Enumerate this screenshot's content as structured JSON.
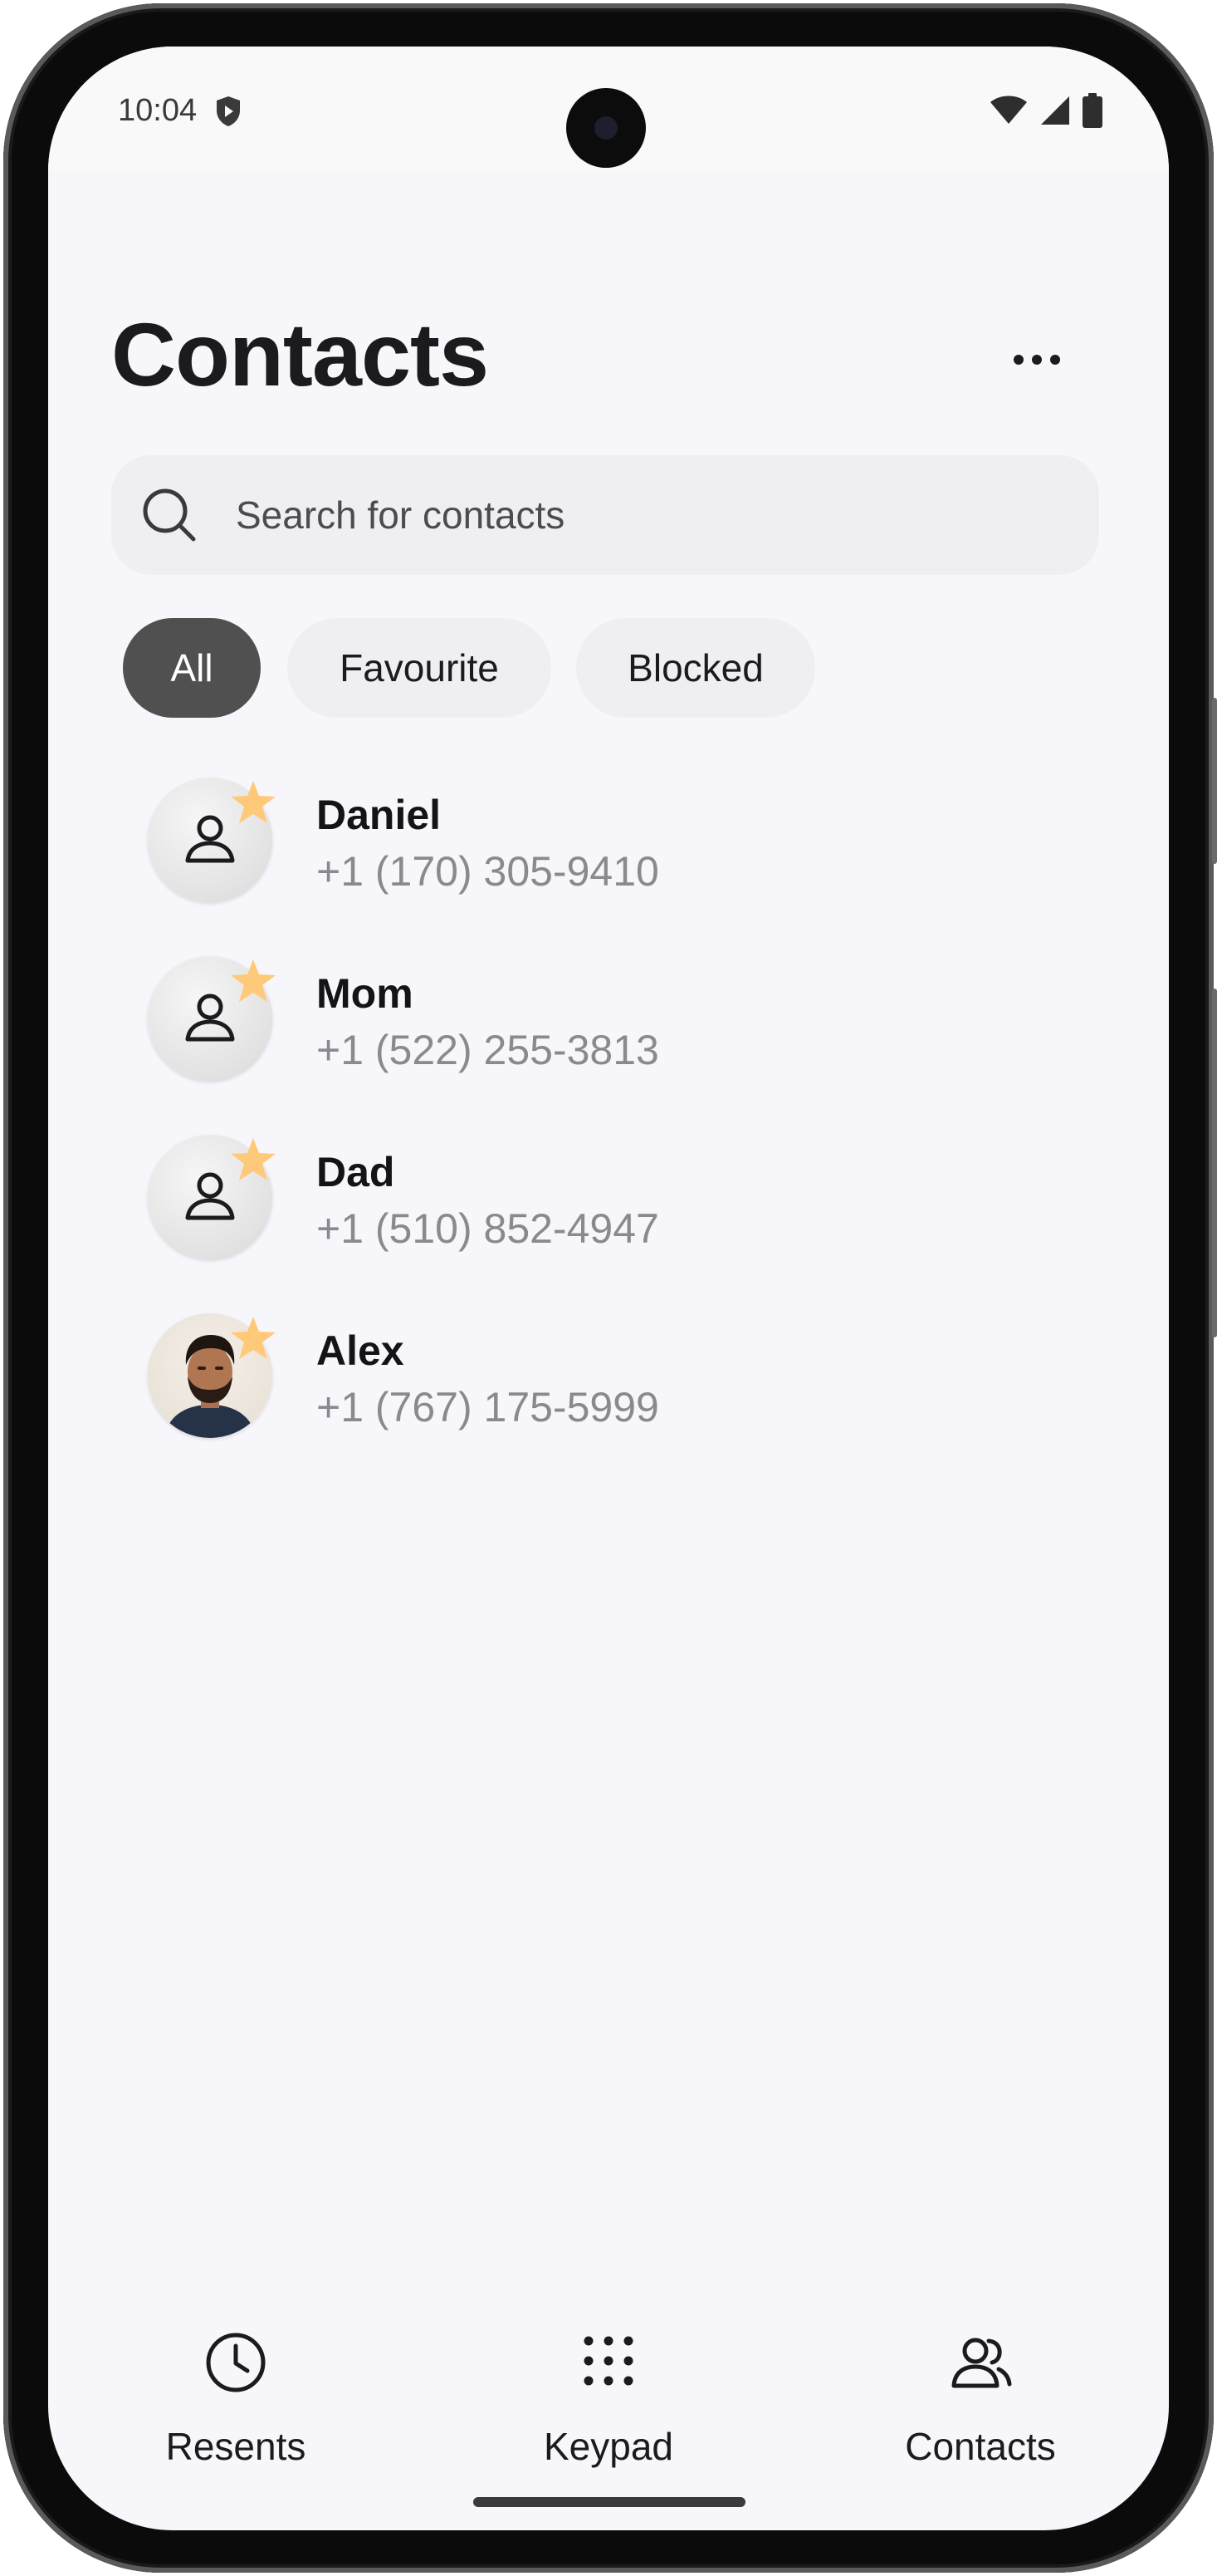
{
  "status_bar": {
    "time": "10:04",
    "icons": [
      "shield-play-icon",
      "wifi-icon",
      "signal-icon",
      "battery-icon"
    ]
  },
  "header": {
    "title": "Contacts",
    "more_icon": "more-horizontal-icon"
  },
  "search": {
    "placeholder": "Search for contacts",
    "value": ""
  },
  "filters": [
    {
      "label": "All",
      "selected": true
    },
    {
      "label": "Favourite",
      "selected": false
    },
    {
      "label": "Blocked",
      "selected": false
    }
  ],
  "contacts": [
    {
      "name": "Daniel",
      "phone": "+1 (170) 305-9410",
      "favourite": true,
      "avatar": "person-placeholder-icon"
    },
    {
      "name": "Mom",
      "phone": "+1 (522) 255-3813",
      "favourite": true,
      "avatar": "person-placeholder-icon"
    },
    {
      "name": "Dad",
      "phone": "+1 (510) 852-4947",
      "favourite": true,
      "avatar": "person-placeholder-icon"
    },
    {
      "name": "Alex",
      "phone": "+1 (767) 175-5999",
      "favourite": true,
      "avatar": "photo"
    }
  ],
  "bottom_nav": [
    {
      "label": "Resents",
      "icon": "clock-icon"
    },
    {
      "label": "Keypad",
      "icon": "dialpad-icon"
    },
    {
      "label": "Contacts",
      "icon": "people-icon"
    }
  ],
  "colors": {
    "screen_bg": "#f7f6fb",
    "chip_selected": "#505050",
    "chip_default": "#efeff1",
    "star": "#ffc97a",
    "phone_text": "#8a8a8e"
  }
}
